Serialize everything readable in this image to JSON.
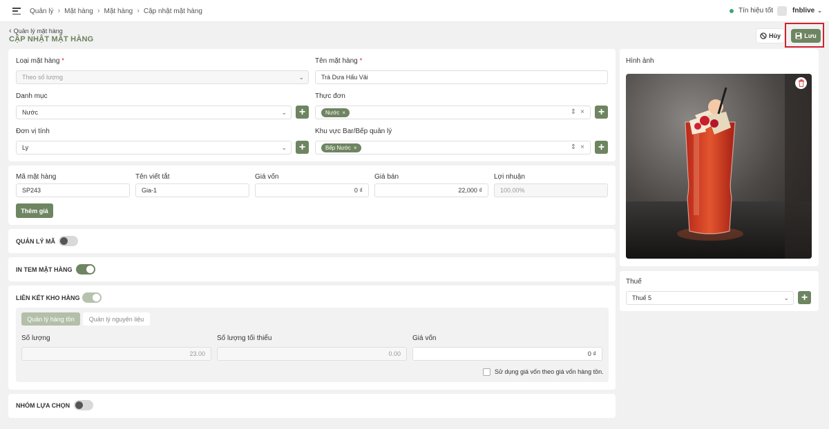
{
  "topbar": {
    "breadcrumb": [
      "Quản lý",
      "Mặt hàng",
      "Mặt hàng",
      "Cập nhật mặt hàng"
    ],
    "signal": "Tín hiệu tốt",
    "user": "fnblive"
  },
  "header": {
    "back": "Quản lý mặt hàng",
    "title": "CẬP NHẬT MẶT HÀNG",
    "cancel": "Hủy",
    "save": "Lưu"
  },
  "general": {
    "loai_label": "Loại mặt hàng",
    "loai_placeholder": "Theo số lượng",
    "ten_label": "Tên mặt hàng",
    "ten_value": "Trà Dưa Hấu Vải",
    "danhmuc_label": "Danh mục",
    "danhmuc_value": "Nước",
    "thucdon_label": "Thực đơn",
    "thucdon_chip": "Nước",
    "donvi_label": "Đơn vị tính",
    "donvi_value": "Ly",
    "khuvuc_label": "Khu vực Bar/Bếp quản lý",
    "khuvuc_chip": "Bếp Nước"
  },
  "pricing": {
    "ma_label": "Mã mặt hàng",
    "ma_value": "SP243",
    "tenviettat_label": "Tên viết tắt",
    "tenviettat_value": "Gia-1",
    "giavon_label": "Giá vốn",
    "giavon_value": "0 ₫",
    "giaban_label": "Giá bán",
    "giaban_value": "22,000 ₫",
    "loinhuan_label": "Lợi nhuận",
    "loinhuan_value": "100.00%",
    "add_price": "Thêm giá"
  },
  "toggles": {
    "quanlyma": "QUẢN LÝ MÃ",
    "intem": "IN TEM MẶT HÀNG",
    "lienket": "LIÊN KẾT KHO HÀNG",
    "nhomluachon": "NHÓM LỰA CHỌN"
  },
  "inventory": {
    "tab_active": "Quản lý hàng tồn",
    "tab_inactive": "Quản lý nguyên liệu",
    "soluong_label": "Số lượng",
    "soluong_value": "23.00",
    "toithieu_label": "Số lượng tối thiểu",
    "toithieu_value": "0.00",
    "giavon_label": "Giá vốn",
    "giavon_value": "0 ₫",
    "checkbox_label": "Sử dụng giá vốn theo giá vốn hàng tồn."
  },
  "image_panel": {
    "label": "Hình ảnh"
  },
  "tax": {
    "label": "Thuế",
    "value": "Thuế 5"
  },
  "colors": {
    "accent": "#6e8561",
    "highlight": "#d0222c"
  }
}
